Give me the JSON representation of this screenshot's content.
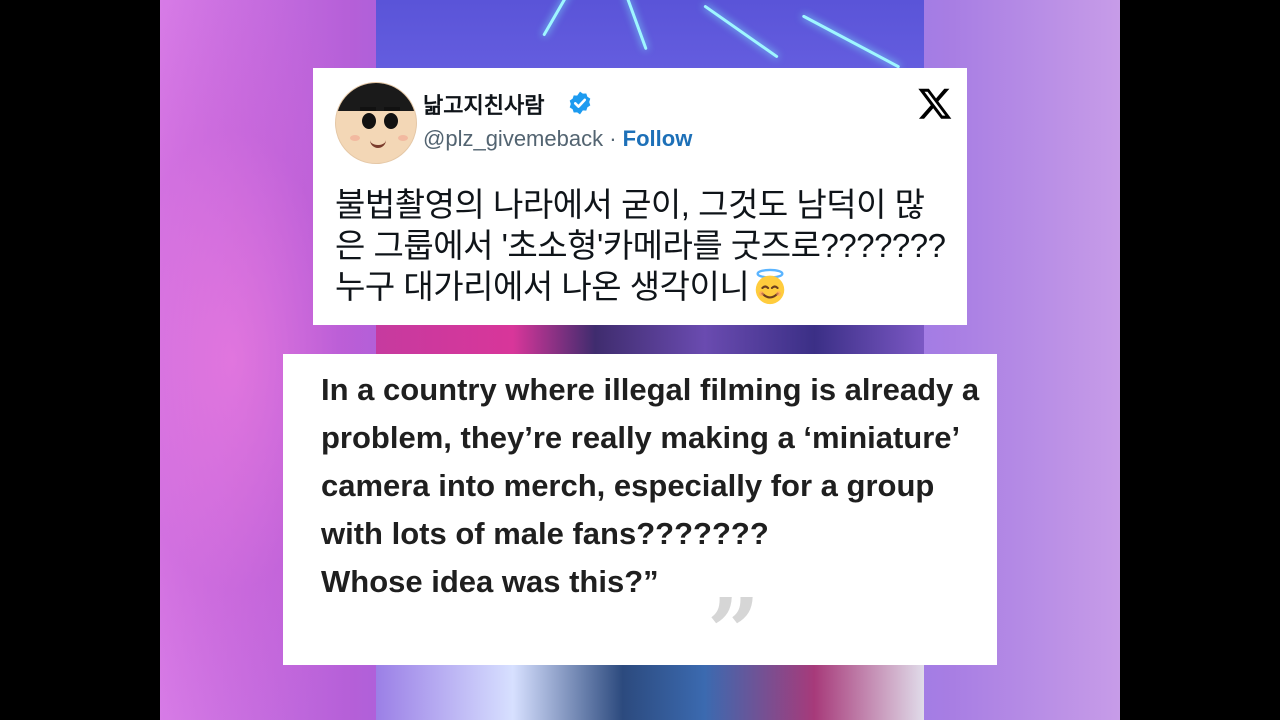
{
  "tweet": {
    "display_name": "낢고지친사람",
    "handle": "@plz_givemeback",
    "separator": " · ",
    "follow_label": "Follow",
    "text_lines": [
      "불법촬영의 나라에서 굳이, 그것도 남덕이 많",
      "은 그룹에서 '초소형'카메라를 굿즈로???????",
      "누구 대가리에서 나온 생각이니"
    ],
    "avatar_icon": "cartoon-avatar-icon",
    "verified_icon": "verified-badge-icon",
    "platform_icon": "x-logo-icon",
    "emoji_icon": "smiling-face-with-halo-icon"
  },
  "translation": {
    "text": "In a country where illegal filming is already a problem, they’re really making a ‘miniature’ camera into merch, especially for a group with lots of male fans???????\nWhose idea was this?”",
    "quote_mark": "”"
  },
  "colors": {
    "follow": "#1d70b8",
    "verified": "#1d9bf0",
    "background_pink": "#d77be6",
    "background_purple": "#7d6ee8"
  }
}
